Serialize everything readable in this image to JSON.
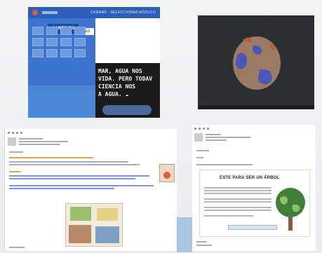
{
  "collage": {
    "header_title": "CERRAR · SELECCIONAR MÓDULO",
    "cartel_label": "CARTELES",
    "chip_label": "ES",
    "chalkboard_lines": [
      "MAR, AGUA NOS",
      "VIDA. PERO TODAV",
      "CIENCIA NOS",
      "A AGUA. ☁"
    ]
  },
  "video": {
    "title": "",
    "globe_colors": {
      "land": "#9b7b63",
      "water": "#4a56b8",
      "accent": "#c05a3a"
    }
  },
  "forum_left": {
    "timestamp": "",
    "highlight_color": "#e6a34a",
    "link_color": "#7f95d8"
  },
  "forum_right": {
    "timestamp": "",
    "card_title": "ESTE PARA SER UN ÁRBOL"
  }
}
